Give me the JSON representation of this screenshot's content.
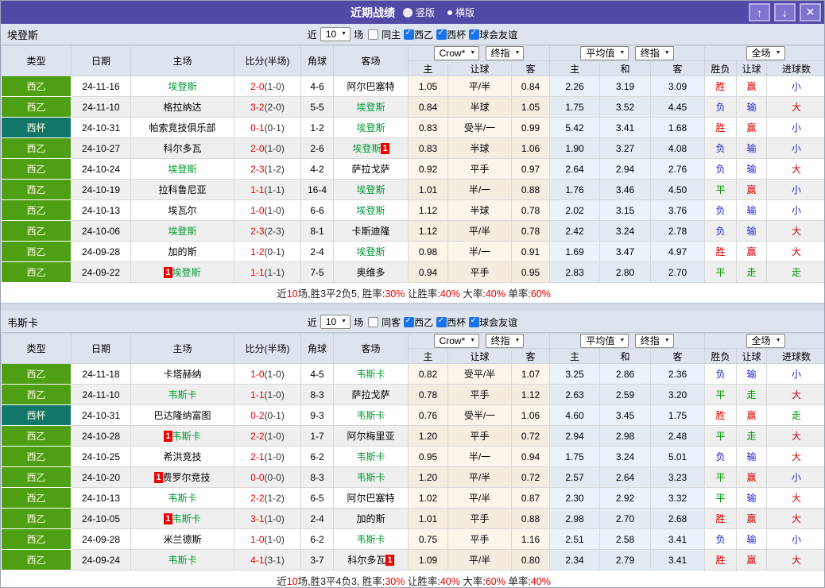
{
  "titlebar": {
    "title": "近期战绩",
    "radios": [
      {
        "label": "竖版",
        "selected": true
      },
      {
        "label": "横版",
        "selected": false
      }
    ],
    "buttons": [
      {
        "name": "move-up",
        "glyph": "↑"
      },
      {
        "name": "move-down",
        "glyph": "↓"
      },
      {
        "name": "close",
        "glyph": "✕"
      }
    ]
  },
  "colors": {
    "titlebar_bg": "#5149a6",
    "league_green": "#4f9f14",
    "cup_teal": "#12776b",
    "team_green": "#009933",
    "win_red": "#d60000",
    "lose_blue": "#2424cc",
    "draw_green": "#009900",
    "checkbox_blue": "#1a73e8",
    "red_num": "#e60000"
  },
  "table_head": {
    "columns": [
      "类型",
      "日期",
      "主场",
      "比分(半场)",
      "角球",
      "客场"
    ],
    "group1": {
      "selects": [
        "Crow*",
        "终指"
      ],
      "subs": [
        "主",
        "让球",
        "客"
      ]
    },
    "group2": {
      "selects": [
        "平均值",
        "终指"
      ],
      "subs": [
        "主",
        "和",
        "客"
      ]
    },
    "group3": {
      "selects": [
        "全场"
      ],
      "subs": [
        "胜负",
        "让球",
        "进球数"
      ]
    }
  },
  "sections": [
    {
      "team": "埃登斯",
      "filter": {
        "prefix": "近",
        "count": "10",
        "suffix": "场",
        "same": {
          "label": "同主",
          "checked": false
        },
        "leagues": [
          {
            "label": "西乙",
            "checked": true
          },
          {
            "label": "西杯",
            "checked": true
          },
          {
            "label": "球会友谊",
            "checked": true
          }
        ]
      },
      "rows": [
        {
          "type": "西乙",
          "cup": false,
          "date": "24-11-16",
          "home": "埃登斯",
          "home_team": true,
          "home_badge": "",
          "score": "2-0",
          "half": "(1-0)",
          "corner": "4-6",
          "away": "阿尔巴塞特",
          "away_team": false,
          "away_badge": "",
          "odds": [
            "1.05",
            "平/半",
            "0.84",
            "2.26",
            "3.19",
            "3.09"
          ],
          "results": [
            {
              "t": "胜",
              "c": "red"
            },
            {
              "t": "赢",
              "c": "red"
            },
            {
              "t": "小",
              "c": "blue"
            }
          ]
        },
        {
          "type": "西乙",
          "cup": false,
          "date": "24-11-10",
          "home": "格拉纳达",
          "home_team": false,
          "home_badge": "",
          "score": "3-2",
          "half": "(2-0)",
          "corner": "5-5",
          "away": "埃登斯",
          "away_team": true,
          "away_badge": "",
          "odds": [
            "0.84",
            "半球",
            "1.05",
            "1.75",
            "3.52",
            "4.45"
          ],
          "results": [
            {
              "t": "负",
              "c": "blue"
            },
            {
              "t": "输",
              "c": "blue"
            },
            {
              "t": "大",
              "c": "red"
            }
          ]
        },
        {
          "type": "西杯",
          "cup": true,
          "date": "24-10-31",
          "home": "帕索竞技俱乐部",
          "home_team": false,
          "home_badge": "",
          "score": "0-1",
          "half": "(0-1)",
          "corner": "1-2",
          "away": "埃登斯",
          "away_team": true,
          "away_badge": "",
          "odds": [
            "0.83",
            "受半/一",
            "0.99",
            "5.42",
            "3.41",
            "1.68"
          ],
          "results": [
            {
              "t": "胜",
              "c": "red"
            },
            {
              "t": "赢",
              "c": "red"
            },
            {
              "t": "小",
              "c": "blue"
            }
          ]
        },
        {
          "type": "西乙",
          "cup": false,
          "date": "24-10-27",
          "home": "科尔多瓦",
          "home_team": false,
          "home_badge": "",
          "score": "2-0",
          "half": "(1-0)",
          "corner": "2-6",
          "away": "埃登斯",
          "away_team": true,
          "away_badge": "1",
          "odds": [
            "0.83",
            "半球",
            "1.06",
            "1.90",
            "3.27",
            "4.08"
          ],
          "results": [
            {
              "t": "负",
              "c": "blue"
            },
            {
              "t": "输",
              "c": "blue"
            },
            {
              "t": "小",
              "c": "blue"
            }
          ]
        },
        {
          "type": "西乙",
          "cup": false,
          "date": "24-10-24",
          "home": "埃登斯",
          "home_team": true,
          "home_badge": "",
          "score": "2-3",
          "half": "(1-2)",
          "corner": "4-2",
          "away": "萨拉戈萨",
          "away_team": false,
          "away_badge": "",
          "odds": [
            "0.92",
            "平手",
            "0.97",
            "2.64",
            "2.94",
            "2.76"
          ],
          "results": [
            {
              "t": "负",
              "c": "blue"
            },
            {
              "t": "输",
              "c": "blue"
            },
            {
              "t": "大",
              "c": "red"
            }
          ]
        },
        {
          "type": "西乙",
          "cup": false,
          "date": "24-10-19",
          "home": "拉科鲁尼亚",
          "home_team": false,
          "home_badge": "",
          "score": "1-1",
          "half": "(1-1)",
          "corner": "16-4",
          "away": "埃登斯",
          "away_team": true,
          "away_badge": "",
          "odds": [
            "1.01",
            "半/一",
            "0.88",
            "1.76",
            "3.46",
            "4.50"
          ],
          "results": [
            {
              "t": "平",
              "c": "green"
            },
            {
              "t": "赢",
              "c": "red"
            },
            {
              "t": "小",
              "c": "blue"
            }
          ]
        },
        {
          "type": "西乙",
          "cup": false,
          "date": "24-10-13",
          "home": "埃瓦尔",
          "home_team": false,
          "home_badge": "",
          "score": "1-0",
          "half": "(1-0)",
          "corner": "6-6",
          "away": "埃登斯",
          "away_team": true,
          "away_badge": "",
          "odds": [
            "1.12",
            "半球",
            "0.78",
            "2.02",
            "3.15",
            "3.76"
          ],
          "results": [
            {
              "t": "负",
              "c": "blue"
            },
            {
              "t": "输",
              "c": "blue"
            },
            {
              "t": "小",
              "c": "blue"
            }
          ]
        },
        {
          "type": "西乙",
          "cup": false,
          "date": "24-10-06",
          "home": "埃登斯",
          "home_team": true,
          "home_badge": "",
          "score": "2-3",
          "half": "(2-3)",
          "corner": "8-1",
          "away": "卡斯迪隆",
          "away_team": false,
          "away_badge": "",
          "odds": [
            "1.12",
            "平/半",
            "0.78",
            "2.42",
            "3.24",
            "2.78"
          ],
          "results": [
            {
              "t": "负",
              "c": "blue"
            },
            {
              "t": "输",
              "c": "blue"
            },
            {
              "t": "大",
              "c": "red"
            }
          ]
        },
        {
          "type": "西乙",
          "cup": false,
          "date": "24-09-28",
          "home": "加的斯",
          "home_team": false,
          "home_badge": "",
          "score": "1-2",
          "half": "(0-1)",
          "corner": "2-4",
          "away": "埃登斯",
          "away_team": true,
          "away_badge": "",
          "odds": [
            "0.98",
            "半/一",
            "0.91",
            "1.69",
            "3.47",
            "4.97"
          ],
          "results": [
            {
              "t": "胜",
              "c": "red"
            },
            {
              "t": "赢",
              "c": "red"
            },
            {
              "t": "大",
              "c": "red"
            }
          ]
        },
        {
          "type": "西乙",
          "cup": false,
          "date": "24-09-22",
          "home": "埃登斯",
          "home_team": true,
          "home_badge": "1",
          "score": "1-1",
          "half": "(1-1)",
          "corner": "7-5",
          "away": "奥维多",
          "away_team": false,
          "away_badge": "",
          "odds": [
            "0.94",
            "平手",
            "0.95",
            "2.83",
            "2.80",
            "2.70"
          ],
          "results": [
            {
              "t": "平",
              "c": "green"
            },
            {
              "t": "走",
              "c": "green"
            },
            {
              "t": "走",
              "c": "green"
            }
          ]
        }
      ],
      "summary": [
        {
          "t": "近",
          "c": "k"
        },
        {
          "t": "10",
          "c": "r"
        },
        {
          "t": "场,胜3平2负5, 胜率:",
          "c": "k"
        },
        {
          "t": "30%",
          "c": "r"
        },
        {
          "t": " 让胜率:",
          "c": "k"
        },
        {
          "t": "40%",
          "c": "r"
        },
        {
          "t": " 大率:",
          "c": "k"
        },
        {
          "t": "40%",
          "c": "r"
        },
        {
          "t": " 单率:",
          "c": "k"
        },
        {
          "t": "60%",
          "c": "r"
        }
      ]
    },
    {
      "team": "韦斯卡",
      "filter": {
        "prefix": "近",
        "count": "10",
        "suffix": "场",
        "same": {
          "label": "同客",
          "checked": false
        },
        "leagues": [
          {
            "label": "西乙",
            "checked": true
          },
          {
            "label": "西杯",
            "checked": true
          },
          {
            "label": "球会友谊",
            "checked": true
          }
        ]
      },
      "rows": [
        {
          "type": "西乙",
          "cup": false,
          "date": "24-11-18",
          "home": "卡塔赫纳",
          "home_team": false,
          "home_badge": "",
          "score": "1-0",
          "half": "(1-0)",
          "corner": "4-5",
          "away": "韦斯卡",
          "away_team": true,
          "away_badge": "",
          "odds": [
            "0.82",
            "受平/半",
            "1.07",
            "3.25",
            "2.86",
            "2.36"
          ],
          "results": [
            {
              "t": "负",
              "c": "blue"
            },
            {
              "t": "输",
              "c": "blue"
            },
            {
              "t": "小",
              "c": "blue"
            }
          ]
        },
        {
          "type": "西乙",
          "cup": false,
          "date": "24-11-10",
          "home": "韦斯卡",
          "home_team": true,
          "home_badge": "",
          "score": "1-1",
          "half": "(1-0)",
          "corner": "8-3",
          "away": "萨拉戈萨",
          "away_team": false,
          "away_badge": "",
          "odds": [
            "0.78",
            "平手",
            "1.12",
            "2.63",
            "2.59",
            "3.20"
          ],
          "results": [
            {
              "t": "平",
              "c": "green"
            },
            {
              "t": "走",
              "c": "green"
            },
            {
              "t": "大",
              "c": "red"
            }
          ]
        },
        {
          "type": "西杯",
          "cup": true,
          "date": "24-10-31",
          "home": "巴达隆纳富图",
          "home_team": false,
          "home_badge": "",
          "score": "0-2",
          "half": "(0-1)",
          "corner": "9-3",
          "away": "韦斯卡",
          "away_team": true,
          "away_badge": "",
          "odds": [
            "0.76",
            "受半/一",
            "1.06",
            "4.60",
            "3.45",
            "1.75"
          ],
          "results": [
            {
              "t": "胜",
              "c": "red"
            },
            {
              "t": "赢",
              "c": "red"
            },
            {
              "t": "走",
              "c": "green"
            }
          ]
        },
        {
          "type": "西乙",
          "cup": false,
          "date": "24-10-28",
          "home": "韦斯卡",
          "home_team": true,
          "home_badge": "1",
          "score": "2-2",
          "half": "(1-0)",
          "corner": "1-7",
          "away": "阿尔梅里亚",
          "away_team": false,
          "away_badge": "",
          "odds": [
            "1.20",
            "平手",
            "0.72",
            "2.94",
            "2.98",
            "2.48"
          ],
          "results": [
            {
              "t": "平",
              "c": "green"
            },
            {
              "t": "走",
              "c": "green"
            },
            {
              "t": "大",
              "c": "red"
            }
          ]
        },
        {
          "type": "西乙",
          "cup": false,
          "date": "24-10-25",
          "home": "希洪竞技",
          "home_team": false,
          "home_badge": "",
          "score": "2-1",
          "half": "(1-0)",
          "corner": "6-2",
          "away": "韦斯卡",
          "away_team": true,
          "away_badge": "",
          "odds": [
            "0.95",
            "半/一",
            "0.94",
            "1.75",
            "3.24",
            "5.01"
          ],
          "results": [
            {
              "t": "负",
              "c": "blue"
            },
            {
              "t": "输",
              "c": "blue"
            },
            {
              "t": "大",
              "c": "red"
            }
          ]
        },
        {
          "type": "西乙",
          "cup": false,
          "date": "24-10-20",
          "home": "费罗尔竞技",
          "home_team": false,
          "home_badge": "1",
          "score": "0-0",
          "half": "(0-0)",
          "corner": "8-3",
          "away": "韦斯卡",
          "away_team": true,
          "away_badge": "",
          "odds": [
            "1.20",
            "平/半",
            "0.72",
            "2.57",
            "2.64",
            "3.23"
          ],
          "results": [
            {
              "t": "平",
              "c": "green"
            },
            {
              "t": "赢",
              "c": "red"
            },
            {
              "t": "小",
              "c": "blue"
            }
          ]
        },
        {
          "type": "西乙",
          "cup": false,
          "date": "24-10-13",
          "home": "韦斯卡",
          "home_team": true,
          "home_badge": "",
          "score": "2-2",
          "half": "(1-2)",
          "corner": "6-5",
          "away": "阿尔巴塞特",
          "away_team": false,
          "away_badge": "",
          "odds": [
            "1.02",
            "平/半",
            "0.87",
            "2.30",
            "2.92",
            "3.32"
          ],
          "results": [
            {
              "t": "平",
              "c": "green"
            },
            {
              "t": "输",
              "c": "blue"
            },
            {
              "t": "大",
              "c": "red"
            }
          ]
        },
        {
          "type": "西乙",
          "cup": false,
          "date": "24-10-05",
          "home": "韦斯卡",
          "home_team": true,
          "home_badge": "1",
          "score": "3-1",
          "half": "(1-0)",
          "corner": "2-4",
          "away": "加的斯",
          "away_team": false,
          "away_badge": "",
          "odds": [
            "1.01",
            "平手",
            "0.88",
            "2.98",
            "2.70",
            "2.68"
          ],
          "results": [
            {
              "t": "胜",
              "c": "red"
            },
            {
              "t": "赢",
              "c": "red"
            },
            {
              "t": "大",
              "c": "red"
            }
          ]
        },
        {
          "type": "西乙",
          "cup": false,
          "date": "24-09-28",
          "home": "米兰德斯",
          "home_team": false,
          "home_badge": "",
          "score": "1-0",
          "half": "(1-0)",
          "corner": "6-2",
          "away": "韦斯卡",
          "away_team": true,
          "away_badge": "",
          "odds": [
            "0.75",
            "平手",
            "1.16",
            "2.51",
            "2.58",
            "3.41"
          ],
          "results": [
            {
              "t": "负",
              "c": "blue"
            },
            {
              "t": "输",
              "c": "blue"
            },
            {
              "t": "小",
              "c": "blue"
            }
          ]
        },
        {
          "type": "西乙",
          "cup": false,
          "date": "24-09-24",
          "home": "韦斯卡",
          "home_team": true,
          "home_badge": "",
          "score": "4-1",
          "half": "(3-1)",
          "corner": "3-7",
          "away": "科尔多瓦",
          "away_team": false,
          "away_badge": "1",
          "odds": [
            "1.09",
            "平/半",
            "0.80",
            "2.34",
            "2.79",
            "3.41"
          ],
          "results": [
            {
              "t": "胜",
              "c": "red"
            },
            {
              "t": "赢",
              "c": "red"
            },
            {
              "t": "大",
              "c": "red"
            }
          ]
        }
      ],
      "summary": [
        {
          "t": "近",
          "c": "k"
        },
        {
          "t": "10",
          "c": "r"
        },
        {
          "t": "场,胜3平4负3, 胜率:",
          "c": "k"
        },
        {
          "t": "30%",
          "c": "r"
        },
        {
          "t": " 让胜率:",
          "c": "k"
        },
        {
          "t": "40%",
          "c": "r"
        },
        {
          "t": " 大率:",
          "c": "k"
        },
        {
          "t": "60%",
          "c": "r"
        },
        {
          "t": " 单率:",
          "c": "k"
        },
        {
          "t": "40%",
          "c": "r"
        }
      ]
    }
  ]
}
